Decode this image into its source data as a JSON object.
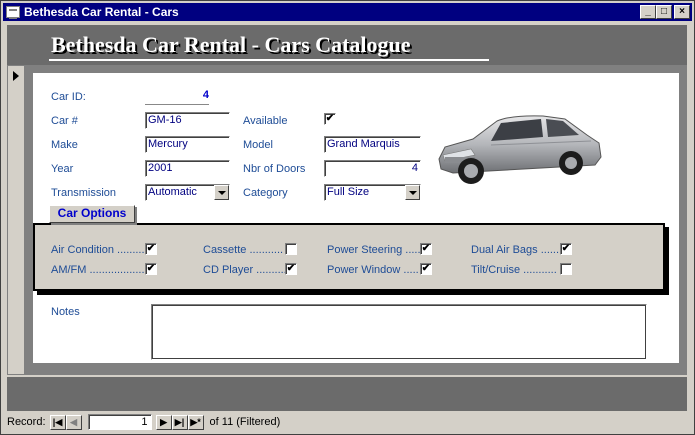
{
  "window": {
    "title": "Bethesda Car Rental - Cars",
    "min": "_",
    "max": "□",
    "close": "×"
  },
  "header": {
    "title": "Bethesda Car Rental - Cars Catalogue"
  },
  "form": {
    "car_id": {
      "label": "Car ID:",
      "value": "4"
    },
    "car_num": {
      "label": "Car #",
      "value": "GM-16"
    },
    "available": {
      "label": "Available",
      "checked": true
    },
    "make": {
      "label": "Make",
      "value": "Mercury"
    },
    "model": {
      "label": "Model",
      "value": "Grand Marquis"
    },
    "year": {
      "label": "Year",
      "value": "2001"
    },
    "doors": {
      "label": "Nbr of Doors",
      "value": "4"
    },
    "transmission": {
      "label": "Transmission",
      "value": "Automatic"
    },
    "category": {
      "label": "Category",
      "value": "Full Size"
    },
    "notes": {
      "label": "Notes",
      "value": ""
    }
  },
  "options": {
    "tab_label": "Car Options",
    "items": [
      {
        "label": "Air Condition .........",
        "checked": true
      },
      {
        "label": "Cassette ...........",
        "checked": false
      },
      {
        "label": "Power Steering .....",
        "checked": true
      },
      {
        "label": "Dual Air Bags ......",
        "checked": true
      },
      {
        "label": "AM/FM ..................",
        "checked": true
      },
      {
        "label": "CD Player ..........",
        "checked": true
      },
      {
        "label": "Power Window .....",
        "checked": true
      },
      {
        "label": "Tilt/Cruise ...........",
        "checked": false
      }
    ]
  },
  "navigation": {
    "record_label": "Record:",
    "current": "1",
    "of_text": "of  11 (Filtered)",
    "first": "|◀",
    "prev": "◀",
    "next": "▶",
    "last": "▶|",
    "new": "▶*"
  },
  "check_glyph": "✔"
}
